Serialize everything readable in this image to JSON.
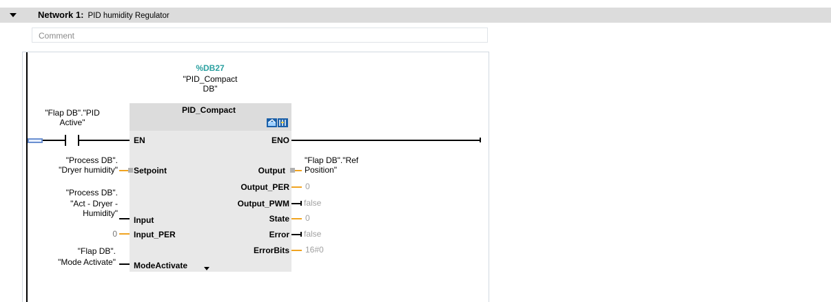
{
  "network": {
    "label": "Network 1:",
    "title": "PID humidity Regulator",
    "comment_placeholder": "Comment"
  },
  "instance": {
    "db": "%DB27",
    "name_line1": "\"PID_Compact",
    "name_line2": "DB\""
  },
  "block": {
    "name": "PID_Compact",
    "en": "EN",
    "eno": "ENO",
    "inputs": [
      "Setpoint",
      "Input",
      "Input_PER",
      "ModeActivate"
    ],
    "outputs": [
      "Output",
      "Output_PER",
      "Output_PWM",
      "State",
      "Error",
      "ErrorBits"
    ]
  },
  "contact": {
    "line1": "\"Flap DB\".\"PID",
    "line2": "Active\""
  },
  "params": {
    "setpoint_1": "\"Process DB\".",
    "setpoint_2": "\"Dryer humidity\"",
    "input_1": "\"Process DB\".",
    "input_2": "\"Act - Dryer -",
    "input_3": "Humidity\"",
    "input_per": "0",
    "mode_1": "\"Flap DB\".",
    "mode_2": "\"Mode Activate\"",
    "output_1": "\"Flap DB\".\"Ref",
    "output_2": "Position\"",
    "output_per": "0",
    "output_pwm": "false",
    "state": "0",
    "error": "false",
    "errorbits": "16#0"
  },
  "colors": {
    "instance_db": "#2aa0a0",
    "wire_orange": "#f0a31f",
    "header_bg": "#dcdcdc"
  },
  "icons": {
    "collapse": "triangle-down-icon",
    "config": "block-config-icon",
    "diag": "diagnostics-icon",
    "expand": "chevron-down-icon"
  }
}
